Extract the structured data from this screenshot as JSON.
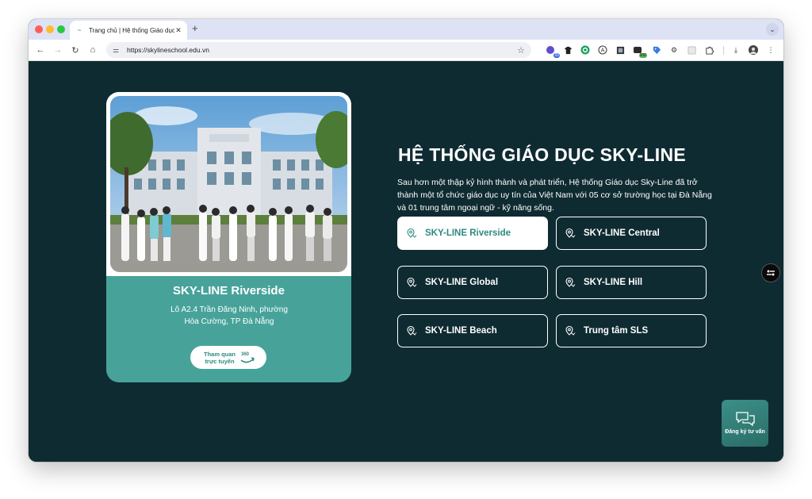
{
  "browser": {
    "tab_title": "Trang chủ | Hệ thống Giáo dục",
    "url": "https://skylineschool.edu.vn",
    "extensions": [
      {
        "icon": "extension-icon-1",
        "badge": "20"
      },
      {
        "icon": "shirt-icon"
      },
      {
        "icon": "grammarly-icon"
      },
      {
        "icon": "a-circle-icon"
      },
      {
        "icon": "grid-icon"
      },
      {
        "icon": "extension-icon-2",
        "badge": "200"
      },
      {
        "icon": "tag-icon"
      },
      {
        "icon": "gear-icon"
      },
      {
        "icon": "square-icon"
      },
      {
        "icon": "puzzle-icon"
      }
    ]
  },
  "card": {
    "title": "SKY-LINE Riverside",
    "address": "Lô A2.4 Trần Đăng Ninh, phường Hòa Cường, TP Đà Nẵng",
    "tour_label": "Tham quan trực tuyến",
    "tour_badge": "360"
  },
  "main": {
    "heading": "HỆ THỐNG GIÁO DỤC SKY-LINE",
    "description": "Sau hơn một thập kỷ hình thành và phát triển, Hệ thống Giáo dục Sky-Line đã trở thành một tổ chức giáo dục uy tín của Việt Nam với 05 cơ sở trường học tại Đà Nẵng và 01 trung tâm ngoại ngữ - kỹ năng sống.",
    "campuses": [
      {
        "label": "SKY-LINE Riverside",
        "active": true
      },
      {
        "label": "SKY-LINE Central",
        "active": false
      },
      {
        "label": "SKY-LINE Global",
        "active": false
      },
      {
        "label": "SKY-LINE Hill",
        "active": false
      },
      {
        "label": "SKY-LINE Beach",
        "active": false
      },
      {
        "label": "Trung tâm SLS",
        "active": false
      }
    ]
  },
  "consult": {
    "label": "Đăng ký tư vấn"
  },
  "colors": {
    "page_bg": "#0f2b32",
    "accent": "#47a39a",
    "accent_text": "#2d8a82"
  }
}
